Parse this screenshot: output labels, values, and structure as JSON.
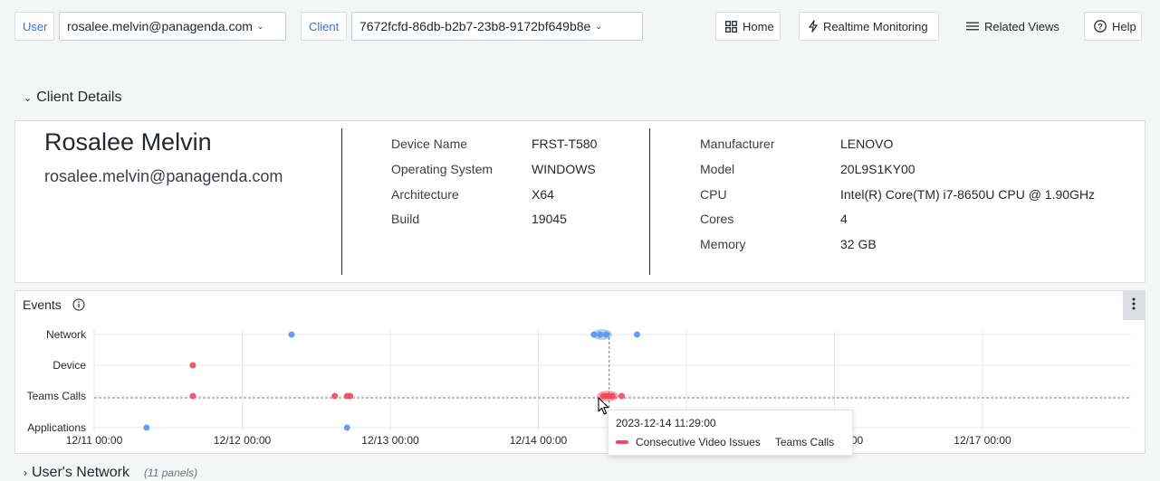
{
  "topbar": {
    "user_label": "User",
    "user_value": "rosalee.melvin@panagenda.com",
    "client_label": "Client",
    "client_value": "7672fcfd-86db-b2b7-23b8-9172bf649b8e",
    "home": "Home",
    "realtime": "Realtime Monitoring",
    "related": "Related Views",
    "help": "Help"
  },
  "client_details": {
    "title": "Client Details",
    "name": "Rosalee Melvin",
    "email": "rosalee.melvin@panagenda.com",
    "device": [
      {
        "key": "Device Name",
        "value": "FRST-T580"
      },
      {
        "key": "Operating System",
        "value": "WINDOWS"
      },
      {
        "key": "Architecture",
        "value": "X64"
      },
      {
        "key": "Build",
        "value": "19045"
      }
    ],
    "hardware": [
      {
        "key": "Manufacturer",
        "value": "LENOVO"
      },
      {
        "key": "Model",
        "value": "20L9S1KY00"
      },
      {
        "key": "CPU",
        "value": "Intel(R) Core(TM) i7-8650U CPU @ 1.90GHz"
      },
      {
        "key": "Cores",
        "value": "4"
      },
      {
        "key": "Memory",
        "value": "32 GB"
      }
    ]
  },
  "events": {
    "title": "Events",
    "colors": {
      "blue": "#5794f2",
      "red": "#f2495c"
    }
  },
  "chart_data": {
    "type": "scatter",
    "categories": [
      "Network",
      "Device",
      "Teams Calls",
      "Applications"
    ],
    "x_ticks": [
      "12/11 00:00",
      "12/12 00:00",
      "12/13 00:00",
      "12/14 00:00",
      "12/15 00:00",
      "12/16 00:00",
      "12/17 00:00"
    ],
    "xlim": [
      "2023-12-11 00:00",
      "2023-12-18 00:00"
    ],
    "grid": true,
    "series": [
      {
        "color": "#5794f2",
        "points": [
          {
            "x": "2023-12-12 08:00",
            "y": "Network"
          },
          {
            "x": "2023-12-14 09:00",
            "y": "Network"
          },
          {
            "x": "2023-12-14 10:00",
            "y": "Network"
          },
          {
            "x": "2023-12-14 11:00",
            "y": "Network"
          },
          {
            "x": "2023-12-14 16:00",
            "y": "Network"
          },
          {
            "x": "2023-12-11 08:30",
            "y": "Applications"
          },
          {
            "x": "2023-12-12 17:00",
            "y": "Applications"
          }
        ]
      },
      {
        "color": "#f2495c",
        "points": [
          {
            "x": "2023-12-11 16:00",
            "y": "Device"
          },
          {
            "x": "2023-12-11 16:00",
            "y": "Teams Calls"
          },
          {
            "x": "2023-12-12 15:00",
            "y": "Teams Calls"
          },
          {
            "x": "2023-12-12 17:00",
            "y": "Teams Calls"
          },
          {
            "x": "2023-12-12 17:30",
            "y": "Teams Calls"
          },
          {
            "x": "2023-12-14 10:30",
            "y": "Teams Calls"
          },
          {
            "x": "2023-12-14 11:00",
            "y": "Teams Calls"
          },
          {
            "x": "2023-12-14 11:29",
            "y": "Teams Calls"
          },
          {
            "x": "2023-12-14 12:00",
            "y": "Teams Calls"
          },
          {
            "x": "2023-12-14 13:30",
            "y": "Teams Calls"
          }
        ]
      }
    ],
    "crosshair": {
      "x": "2023-12-14 11:29",
      "y": "Teams Calls"
    }
  },
  "tooltip": {
    "time": "2023-12-14 11:29:00",
    "label": "Consecutive Video Issues",
    "group": "Teams Calls"
  },
  "users_network": {
    "title": "User's Network",
    "panels": "(11 panels)"
  }
}
